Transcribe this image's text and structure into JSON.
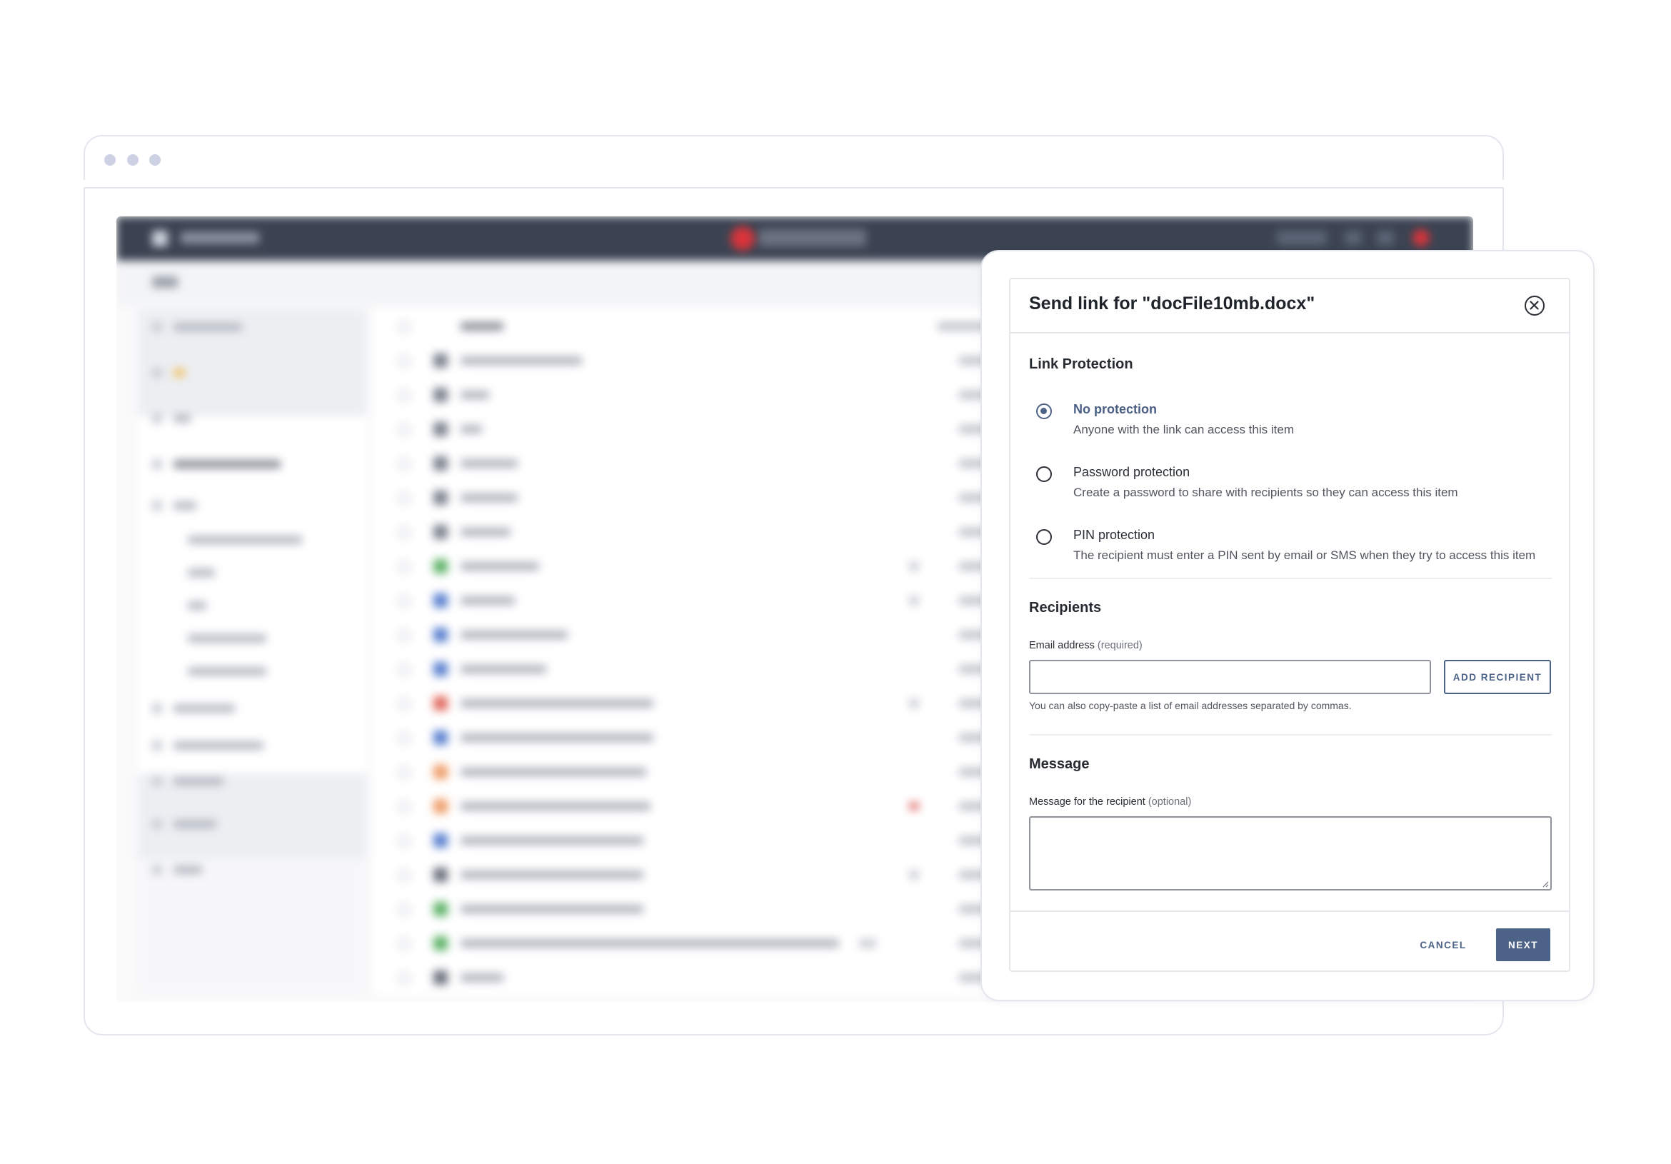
{
  "dialog": {
    "title": "Send link for \"docFile10mb.docx\"",
    "close_icon": "close-circle-icon"
  },
  "link_protection": {
    "heading": "Link Protection",
    "selected": "No protection",
    "options": [
      {
        "label": "No protection",
        "description": "Anyone with the link can access this item"
      },
      {
        "label": "Password protection",
        "description": "Create a password to share with recipients so they can access this item"
      },
      {
        "label": "PIN protection",
        "description": "The recipient must enter a PIN sent by email or SMS when they try to access this item"
      }
    ]
  },
  "recipients": {
    "heading": "Recipients",
    "email_label": "Email address",
    "email_qualifier": "(required)",
    "email_value": "",
    "add_button": "ADD RECIPIENT",
    "hint": "You can also copy-paste a list of email addresses separated by commas."
  },
  "message": {
    "heading": "Message",
    "label": "Message for the recipient",
    "qualifier": "(optional)",
    "value": ""
  },
  "footer": {
    "cancel": "CANCEL",
    "next": "NEXT"
  },
  "colors": {
    "accent": "#4c6287",
    "app_header": "#3b4352",
    "brand_red": "#d8343a"
  }
}
